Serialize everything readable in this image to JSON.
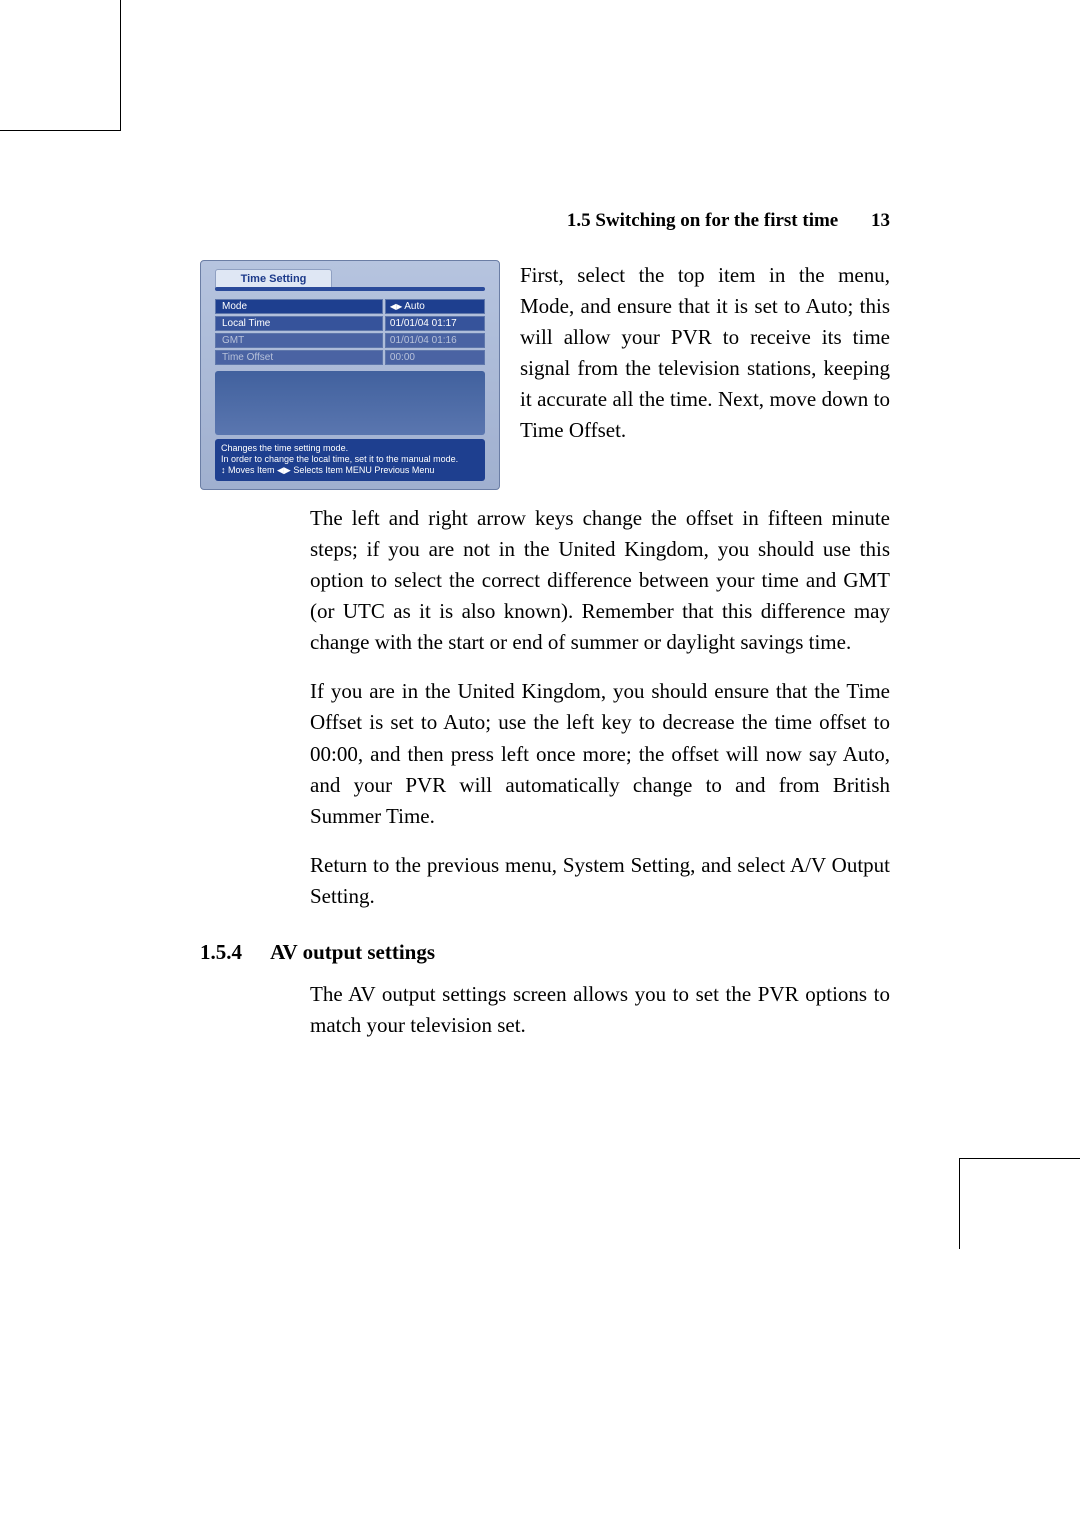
{
  "header": {
    "section_label": "1.5 Switching on for the first time",
    "page_number": "13"
  },
  "figure": {
    "title": "Time Setting",
    "rows": [
      {
        "label": "Mode",
        "value": "Auto",
        "style": "sel",
        "arrows": true
      },
      {
        "label": "Local Time",
        "value": "01/01/04 01:17",
        "style": "",
        "arrows": false
      },
      {
        "label": "GMT",
        "value": "01/01/04 01:16",
        "style": "dim",
        "arrows": false
      },
      {
        "label": "Time Offset",
        "value": "00:00",
        "style": "dim",
        "arrows": false
      }
    ],
    "hint_line1": "Changes the time setting mode.",
    "hint_line2": "In order to change the local time, set it to the manual mode.",
    "hint_line3": "↕ Moves Item  ◀▶ Selects Item  MENU Previous Menu"
  },
  "body": {
    "p1": "First, select the top item in the menu, Mode, and ensure that it is set to Auto; this will allow your PVR to receive its time signal from the television stations, keeping it accurate all the time. Next, move down to Time Offset.",
    "p2": "The left and right arrow keys change the offset in fifteen minute steps; if you are not in the United Kingdom, you should use this option to select the correct difference between your time and GMT (or UTC as it is also known). Remember that this difference may change with the start or end of summer or daylight savings time.",
    "p3": "If you are in the United Kingdom, you should ensure that the Time Offset is set to Auto; use the left key to decrease the time offset to 00:00, and then press left once more; the offset will now say Auto, and your PVR will automatically change to and from British Summer Time.",
    "p4": "Return to the previous menu, System Setting, and select A/V Output Setting.",
    "p5": "The AV output settings screen allows you to set the PVR options to match your television set."
  },
  "section": {
    "number": "1.5.4",
    "title": "AV output settings"
  }
}
